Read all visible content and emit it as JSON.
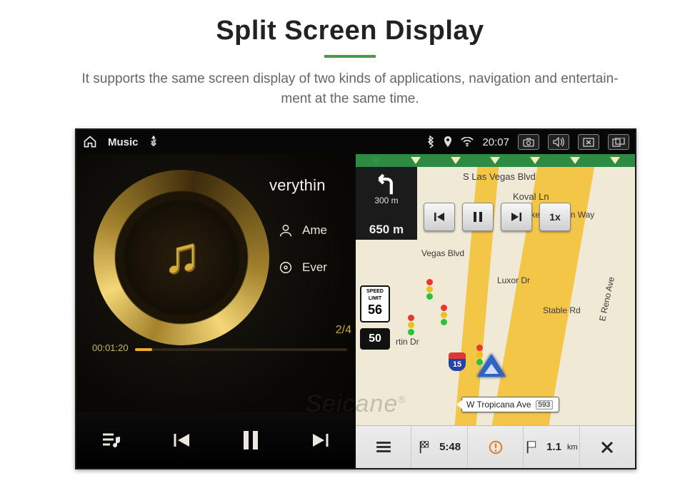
{
  "page": {
    "title": "Split Screen Display",
    "subtitle_line1": "It supports the same screen display of two kinds of applications, navigation and entertain-",
    "subtitle_line2": "ment at the same time."
  },
  "statusbar": {
    "music_label": "Music",
    "clock": "20:07"
  },
  "music": {
    "song_title": "verythin",
    "artist": "Ame",
    "album": "Ever",
    "track_index": "2/4",
    "time_elapsed": "00:01:20",
    "time_total": "",
    "progress_pct": 8
  },
  "nav": {
    "top_street": "S Las Vegas Blvd",
    "turn": {
      "small_dist": "300 m",
      "large_dist": "650 m"
    },
    "sim_speed_label": "1x",
    "speed_sign": {
      "label_top": "SPEED",
      "label_mid": "LIMIT",
      "value": "56"
    },
    "current_speed": "50",
    "interstate_shield": "15",
    "streets": {
      "koval": "Koval Ln",
      "duke": "Duke Ellington Way",
      "vegas_blvd": "Vegas Blvd",
      "luxor": "Luxor Dr",
      "reno": "E Reno Ave",
      "stable": "Stable Rd",
      "martin": "rtin Dr"
    },
    "dest_sign": {
      "street": "W Tropicana Ave",
      "num": "593"
    },
    "bottom": {
      "eta": "5:48",
      "dist": "1.1",
      "dist_unit": "km"
    }
  },
  "watermark": "Seicane"
}
